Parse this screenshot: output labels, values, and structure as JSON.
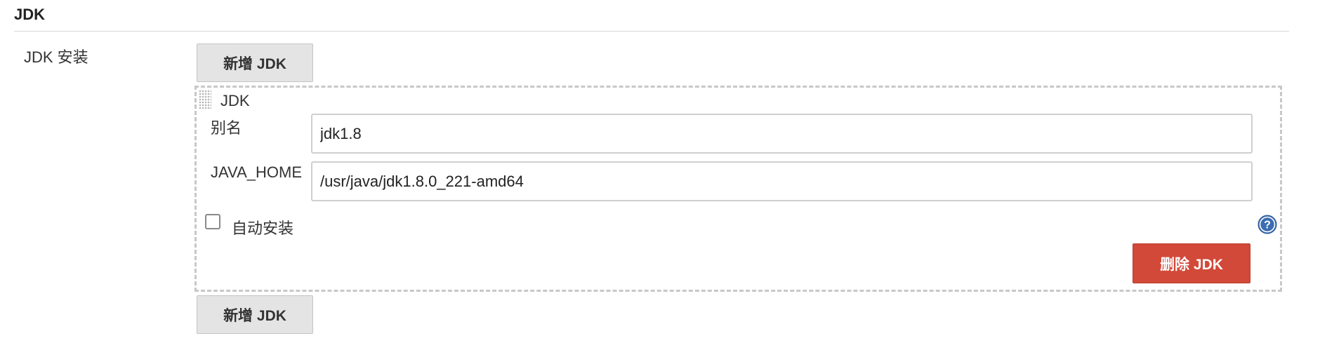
{
  "section": {
    "title": "JDK"
  },
  "row": {
    "label": "JDK 安装"
  },
  "buttons": {
    "add_top": "新增 JDK",
    "add_bottom": "新增 JDK",
    "delete": "删除 JDK"
  },
  "jdk_block": {
    "title": "JDK",
    "alias_label": "别名",
    "alias_value": "jdk1.8",
    "java_home_label": "JAVA_HOME",
    "java_home_value": "/usr/java/jdk1.8.0_221-amd64",
    "auto_install_label": "自动安装",
    "auto_install_checked": false
  },
  "icons": {
    "drag": "drag-handle-icon",
    "help": "help-icon"
  },
  "colors": {
    "delete_button": "#d24939",
    "help_icon": "#3a6db2"
  }
}
